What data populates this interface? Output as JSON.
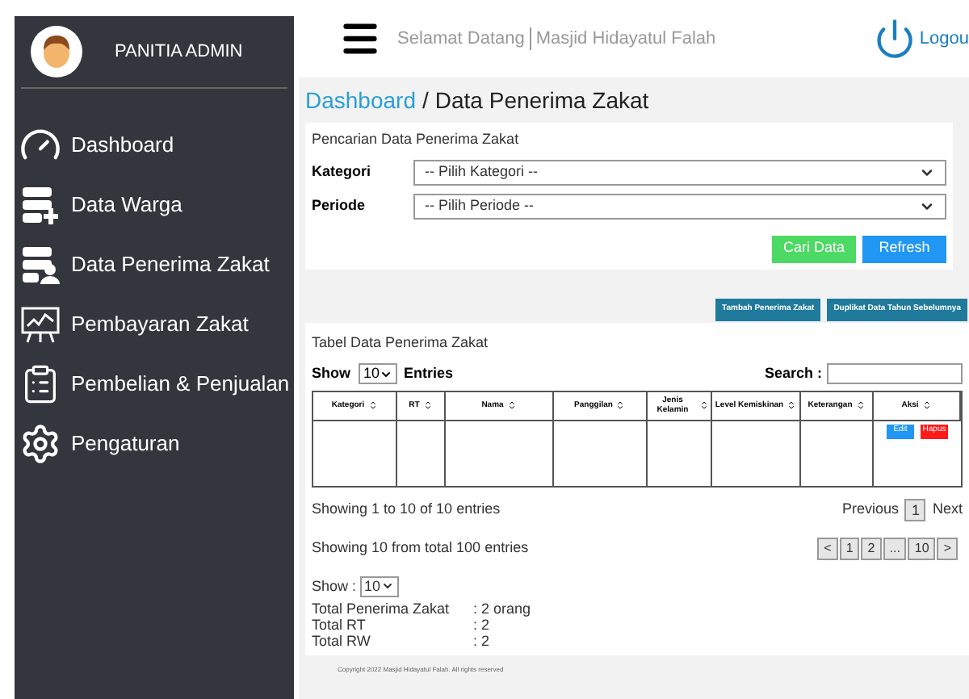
{
  "sidebar": {
    "user": "PANITIA ADMIN",
    "items": [
      {
        "label": "Dashboard"
      },
      {
        "label": "Data Warga"
      },
      {
        "label": "Data Penerima Zakat"
      },
      {
        "label": "Pembayaran Zakat"
      },
      {
        "label": "Pembelian & Penjualan"
      },
      {
        "label": "Pengaturan"
      }
    ]
  },
  "header": {
    "greeting": "Selamat Datang",
    "site": "Masjid Hidayatul Falah",
    "logout": "Logou"
  },
  "breadcrumb": {
    "parent": "Dashboard",
    "separator": "/",
    "current": "Data Penerima Zakat"
  },
  "search_panel": {
    "title": "Pencarian Data Penerima Zakat",
    "fields": [
      {
        "label": "Kategori",
        "value": "-- Pilih Kategori --"
      },
      {
        "label": "Periode",
        "value": "-- Pilih Periode --"
      }
    ],
    "buttons": [
      {
        "label": "Cari Data",
        "kind": "success"
      },
      {
        "label": "Refresh",
        "kind": "primary"
      }
    ]
  },
  "actions": [
    "Tambah Penerima Zakat",
    "Duplikat Data Tahun Sebelumnya"
  ],
  "table": {
    "title": "Tabel Data Penerima Zakat",
    "show_label": "Show",
    "page_size": "10",
    "entries_label": "Entries",
    "search_label": "Search :",
    "columns": [
      "Kategori",
      "RT",
      "Nama",
      "Panggilan",
      "Jenis Kelamin",
      "Level Kemiskinan",
      "Keterangan",
      "Aksi"
    ],
    "row_actions": [
      {
        "label": "Edit",
        "kind": "primary"
      },
      {
        "label": "Hapus",
        "kind": "danger"
      }
    ],
    "info": "Showing 1 to 10 of 10 entries",
    "previous": "Previous",
    "current_page": "1",
    "next": "Next"
  },
  "pager": {
    "info": "Showing 10 from total 100 entries",
    "pages": [
      "<",
      "1",
      "2",
      "...",
      "10",
      ">"
    ]
  },
  "summary": {
    "show_label": "Show :",
    "page_size": "10",
    "lines": [
      {
        "label": "Total Penerima Zakat",
        "value": ": 2 orang"
      },
      {
        "label": "Total RT",
        "value": ": 2"
      },
      {
        "label": "Total RW",
        "value": ": 2"
      }
    ]
  },
  "footer": "Copyright   2022 Masjid Hidayatul Falah. All rights reserved"
}
